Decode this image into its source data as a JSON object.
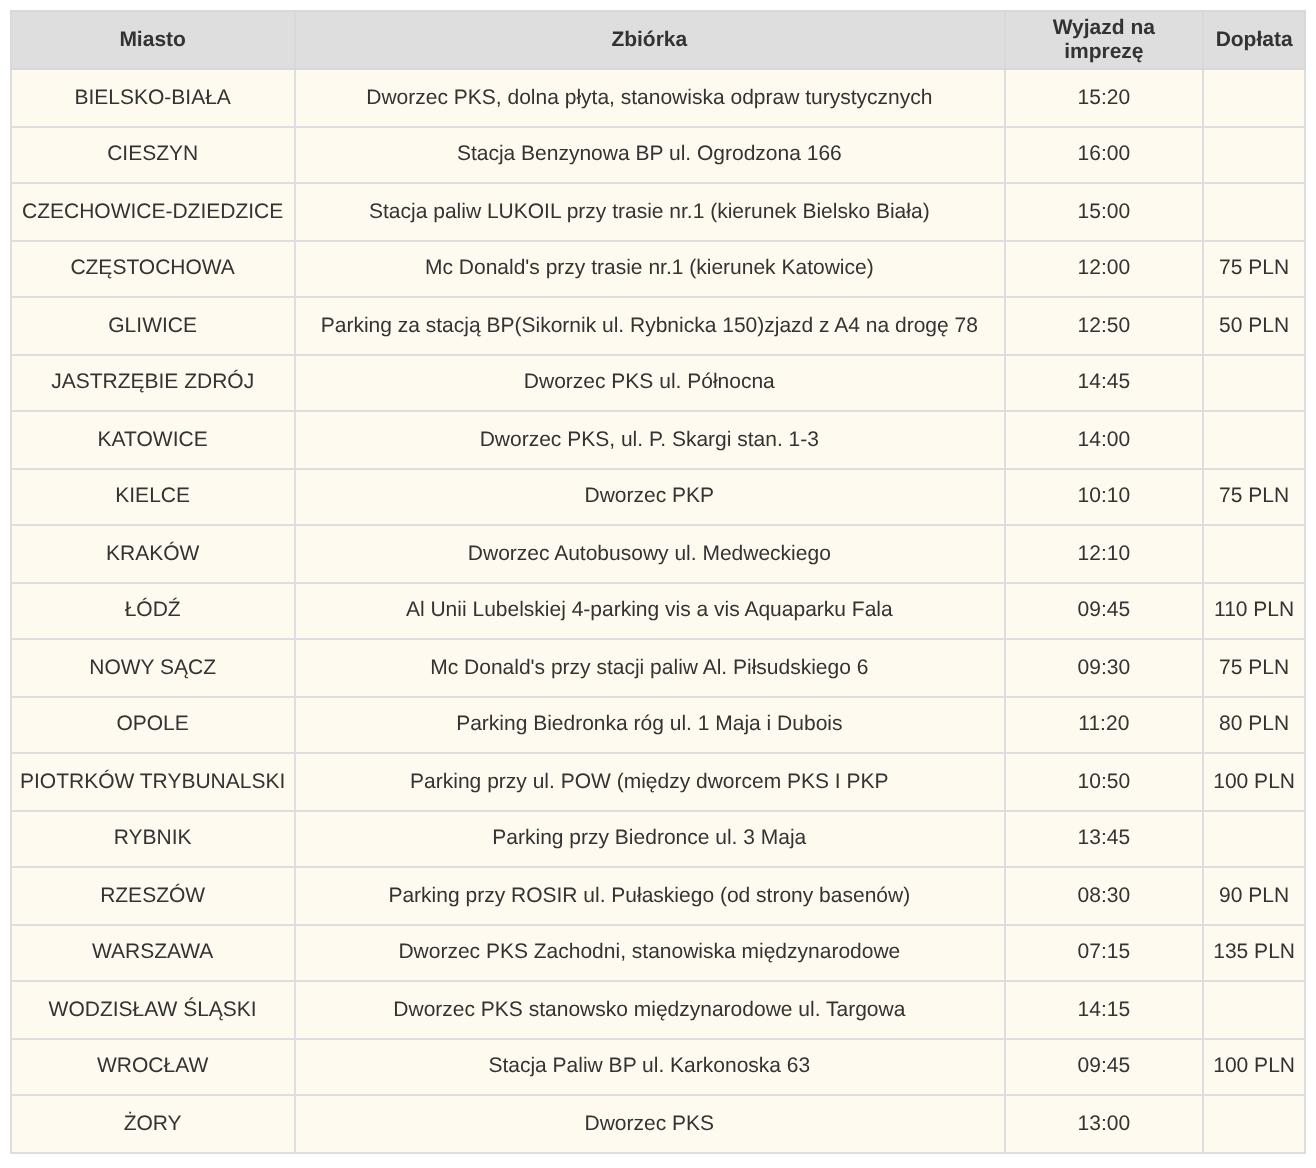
{
  "table": {
    "columns": [
      "Miasto",
      "Zbiórka",
      "Wyjazd na imprezę",
      "Dopłata"
    ],
    "rows": [
      {
        "city": "BIELSKO-BIAŁA",
        "meeting_point": "Dworzec PKS, dolna płyta, stanowiska odpraw turystycznych",
        "departure": "15:20"
      },
      {
        "city": "CIESZYN",
        "meeting_point": "Stacja Benzynowa BP ul. Ogrodzona 166",
        "departure": "16:00"
      },
      {
        "city": "CZECHOWICE-DZIEDZICE",
        "meeting_point": "Stacja paliw LUKOIL przy trasie nr.1 (kierunek Bielsko Biała)",
        "departure": "15:00"
      },
      {
        "city": "CZĘSTOCHOWA",
        "meeting_point": "Mc Donald's przy trasie nr.1 (kierunek Katowice)",
        "departure": "12:00",
        "surcharge": "75 PLN"
      },
      {
        "city": "GLIWICE",
        "meeting_point": "Parking za stacją BP(Sikornik ul. Rybnicka 150)zjazd z A4 na drogę 78",
        "departure": "12:50",
        "surcharge": "50 PLN"
      },
      {
        "city": "JASTRZĘBIE ZDRÓJ",
        "meeting_point": "Dworzec PKS ul. Północna",
        "departure": "14:45"
      },
      {
        "city": "KATOWICE",
        "meeting_point": "Dworzec PKS, ul. P. Skargi stan. 1-3",
        "departure": "14:00"
      },
      {
        "city": "KIELCE",
        "meeting_point": "Dworzec PKP",
        "departure": "10:10",
        "surcharge": "75 PLN"
      },
      {
        "city": "KRAKÓW",
        "meeting_point": "Dworzec Autobusowy ul. Medweckiego",
        "departure": "12:10"
      },
      {
        "city": "ŁÓDŹ",
        "meeting_point": "Al Unii Lubelskiej 4-parking vis a vis Aquaparku Fala",
        "departure": "09:45",
        "surcharge": "110 PLN"
      },
      {
        "city": "NOWY SĄCZ",
        "meeting_point": "Mc Donald's przy stacji paliw Al. Piłsudskiego 6",
        "departure": "09:30",
        "surcharge": "75 PLN"
      },
      {
        "city": "OPOLE",
        "meeting_point": "Parking Biedronka róg ul. 1 Maja i Dubois",
        "departure": "11:20",
        "surcharge": "80 PLN"
      },
      {
        "city": "PIOTRKÓW TRYBUNALSKI",
        "meeting_point": "Parking przy ul. POW (między dworcem PKS I PKP",
        "departure": "10:50",
        "surcharge": "100 PLN"
      },
      {
        "city": "RYBNIK",
        "meeting_point": "Parking przy Biedronce ul. 3 Maja",
        "departure": "13:45"
      },
      {
        "city": "RZESZÓW",
        "meeting_point": "Parking przy ROSIR ul. Pułaskiego (od strony basenów)",
        "departure": "08:30",
        "surcharge": "90 PLN"
      },
      {
        "city": "WARSZAWA",
        "meeting_point": "Dworzec PKS Zachodni, stanowiska międzynarodowe",
        "departure": "07:15",
        "surcharge": "135 PLN"
      },
      {
        "city": "WODZISŁAW ŚLĄSKI",
        "meeting_point": "Dworzec PKS stanowsko międzynarodowe ul. Targowa",
        "departure": "14:15"
      },
      {
        "city": "WROCŁAW",
        "meeting_point": "Stacja Paliw BP ul. Karkonoska 63",
        "departure": "09:45",
        "surcharge": "100 PLN"
      },
      {
        "city": "ŻORY",
        "meeting_point": "Dworzec PKS",
        "departure": "13:00"
      }
    ]
  }
}
